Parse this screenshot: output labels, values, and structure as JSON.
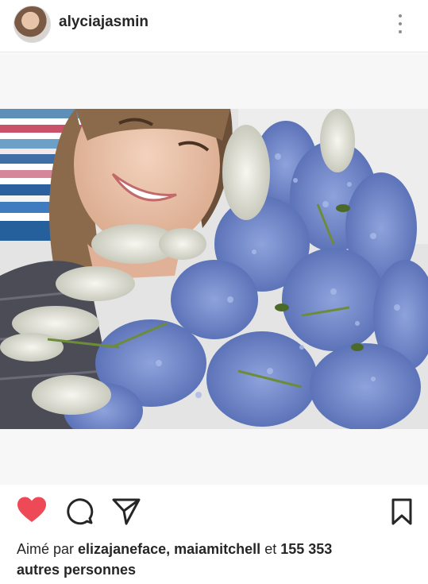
{
  "post": {
    "username": "alycia​jasmin",
    "more_icon": "more-vertical-icon",
    "photo_alt": ""
  },
  "actions": {
    "like_icon": "heart-icon",
    "like_color": "#ed4956",
    "comment_icon": "comment-icon",
    "share_icon": "send-icon",
    "save_icon": "bookmark-icon"
  },
  "likes": {
    "prefix": "Aimé par",
    "user1": "elizajaneface,",
    "user2": "maiamitchell",
    "conjunction": "et",
    "count": "155 353",
    "suffix": "autres personnes"
  }
}
